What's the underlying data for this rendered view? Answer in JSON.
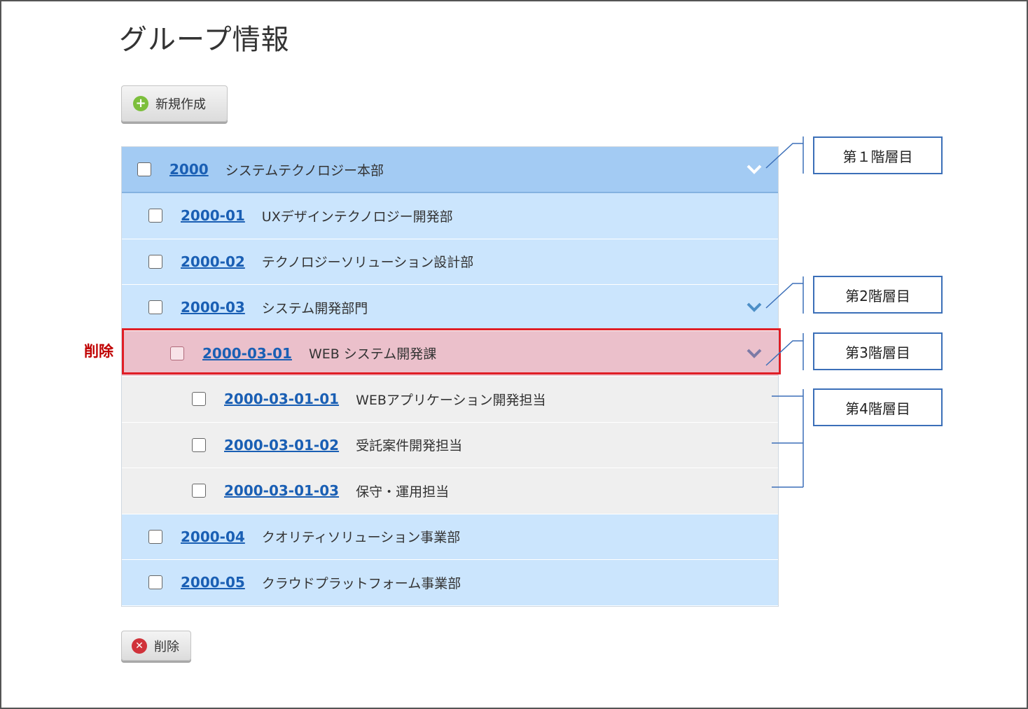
{
  "page": {
    "title": "グループ情報"
  },
  "toolbar": {
    "create_label": "新規作成",
    "delete_label": "削除"
  },
  "groups": [
    {
      "code": "2000",
      "name": "システムテクノロジー本部"
    },
    {
      "code": "2000-01",
      "name": "UXデザインテクノロジー開発部"
    },
    {
      "code": "2000-02",
      "name": "テクノロジーソリューション設計部"
    },
    {
      "code": "2000-03",
      "name": "システム開発部門"
    },
    {
      "code": "2000-03-01",
      "name": "WEB システム開発課"
    },
    {
      "code": "2000-03-01-01",
      "name": "WEBアプリケーション開発担当"
    },
    {
      "code": "2000-03-01-02",
      "name": "受託案件開発担当"
    },
    {
      "code": "2000-03-01-03",
      "name": "保守・運用担当"
    },
    {
      "code": "2000-04",
      "name": "クオリティソリューション事業部"
    },
    {
      "code": "2000-05",
      "name": "クラウドプラットフォーム事業部"
    }
  ],
  "annotations": {
    "delete_marker": "削除",
    "level1": "第１階層目",
    "level2": "第2階層目",
    "level3": "第3階層目",
    "level4": "第4階層目"
  },
  "colors": {
    "level1_bg": "#a3cbf3",
    "level2_bg": "#cbe5fd",
    "level3_bg": "#ebc0cb",
    "level4_bg": "#efefef",
    "highlight_border": "#e01e26",
    "link": "#1a5fb4"
  },
  "icons": {
    "create": "plus-circle-icon",
    "delete": "x-circle-icon",
    "expand": "chevron-down-icon"
  }
}
